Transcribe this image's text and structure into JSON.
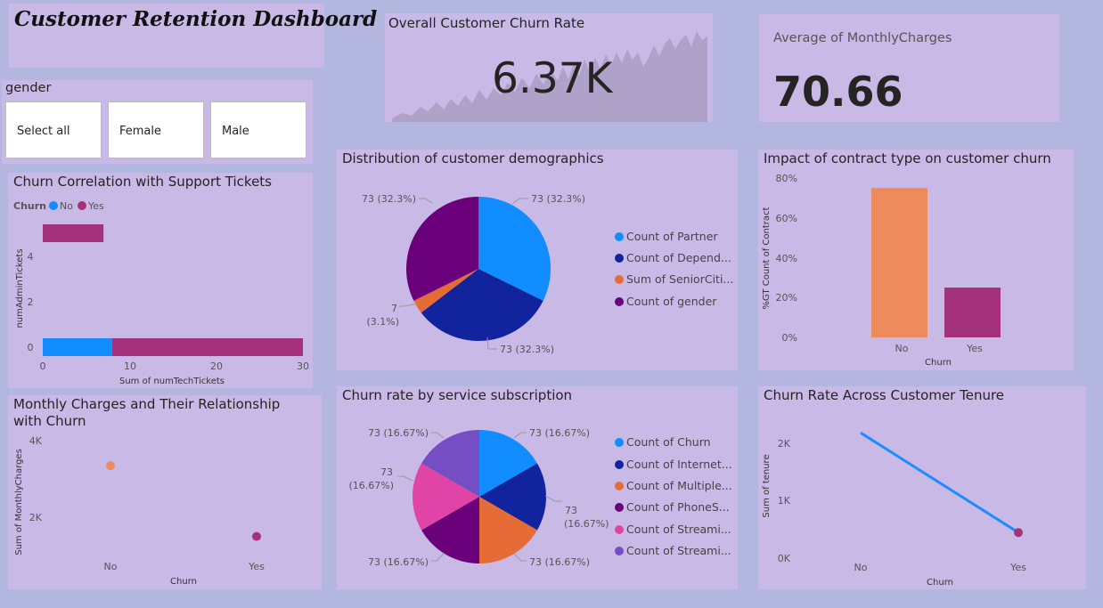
{
  "title": "Customer Retention Dashboard",
  "colors": {
    "churn_no": "#118dff",
    "churn_yes": "#a4317c",
    "navy": "#12239e",
    "orange": "#e66c37",
    "purple": "#6b007b",
    "pink": "#e044a7",
    "violet": "#744ec2",
    "bar_no": "#ee8b5c",
    "line": "#1f8cfe"
  },
  "kpi_churn": {
    "label": "Overall Customer Churn Rate",
    "value": "6.37K"
  },
  "kpi_monthly": {
    "label": "Average of MonthlyCharges",
    "value": "70.66"
  },
  "gender_slicer": {
    "label": "gender",
    "options": [
      "Select all",
      "Female",
      "Male"
    ]
  },
  "chart_data": [
    {
      "id": "support_tickets",
      "type": "bar",
      "title": "Churn Correlation with Support Tickets",
      "legend_title": "Churn",
      "legend": [
        "No",
        "Yes"
      ],
      "xlabel": "Sum of numTechTickets",
      "ylabel": "numAdminTickets",
      "x_ticks": [
        "0",
        "10",
        "20",
        "30"
      ],
      "y_ticks": [
        "0",
        "2",
        "4"
      ],
      "xlim": [
        0,
        30
      ],
      "categories": [
        "0",
        "5"
      ],
      "series": [
        {
          "name": "No",
          "values": [
            8,
            0
          ]
        },
        {
          "name": "Yes",
          "values": [
            22,
            7
          ]
        }
      ]
    },
    {
      "id": "monthly_charges",
      "type": "scatter",
      "title": "Monthly Charges and Their Relationship with Churn",
      "xlabel": "Churn",
      "ylabel": "Sum of MonthlyCharges",
      "categories": [
        "No",
        "Yes"
      ],
      "y_ticks": [
        "2K",
        "4K"
      ],
      "ylim": [
        1000,
        4300
      ],
      "points": [
        {
          "x": "No",
          "y": 3600
        },
        {
          "x": "Yes",
          "y": 1630
        }
      ]
    },
    {
      "id": "demographics",
      "type": "pie",
      "title": "Distribution of customer demographics",
      "slices": [
        {
          "name": "Count of Partner",
          "value": 73,
          "label": "73 (32.3%)"
        },
        {
          "name": "Count of Depend...",
          "value": 73,
          "label": "73 (32.3%)"
        },
        {
          "name": "Sum of SeniorCiti...",
          "value": 7,
          "label": "7\n(3.1%)"
        },
        {
          "name": "Count of gender",
          "value": 73,
          "label": "73 (32.3%)"
        }
      ]
    },
    {
      "id": "contract_type",
      "type": "bar",
      "title": "Impact of contract type on customer churn",
      "xlabel": "Churn",
      "ylabel": "%GT Count of Contract",
      "categories": [
        "No",
        "Yes"
      ],
      "values": [
        75,
        25
      ],
      "ylim": [
        0,
        80
      ],
      "y_ticks": [
        "0%",
        "20%",
        "40%",
        "60%",
        "80%"
      ]
    },
    {
      "id": "service_subscription",
      "type": "pie",
      "title": "Churn rate by service subscription",
      "slices": [
        {
          "name": "Count of Churn",
          "value": 73,
          "label": "73 (16.67%)"
        },
        {
          "name": "Count of Internet...",
          "value": 73,
          "label": "73\n(16.67%)"
        },
        {
          "name": "Count of Multiple...",
          "value": 73,
          "label": "73 (16.67%)"
        },
        {
          "name": "Count of PhoneS...",
          "value": 73,
          "label": "73 (16.67%)"
        },
        {
          "name": "Count of Streami...",
          "value": 73,
          "label": "73\n(16.67%)"
        },
        {
          "name": "Count of Streami...",
          "value": 73,
          "label": "73 (16.67%)"
        }
      ]
    },
    {
      "id": "tenure",
      "type": "line",
      "title": "Churn Rate Across Customer Tenure",
      "xlabel": "Churn",
      "ylabel": "Sum of tenure",
      "categories": [
        "No",
        "Yes"
      ],
      "values": [
        2200,
        450
      ],
      "ylim": [
        0,
        2500
      ],
      "y_ticks": [
        "0K",
        "1K",
        "2K"
      ]
    }
  ]
}
